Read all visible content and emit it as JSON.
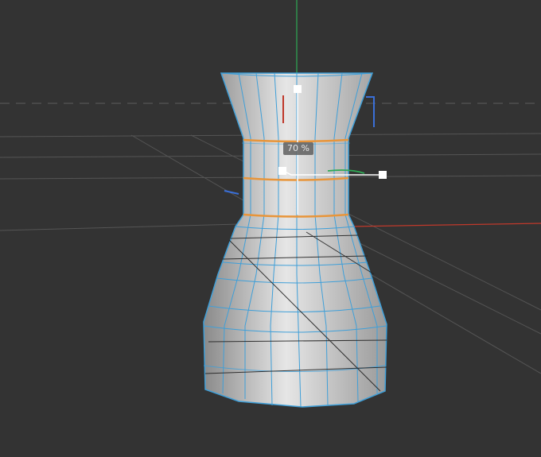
{
  "viewport": {
    "background": "#333333",
    "colors": {
      "y_axis": "#2faa55",
      "x_axis": "#c0392b",
      "mesh_edge": "#3f9fd8",
      "selected_edge": "#e8953a",
      "surface": "#c8c8c8",
      "grid": "#5a5a5a",
      "handle": "#ffffff"
    },
    "gizmo": {
      "percent_label": "70 %"
    }
  }
}
